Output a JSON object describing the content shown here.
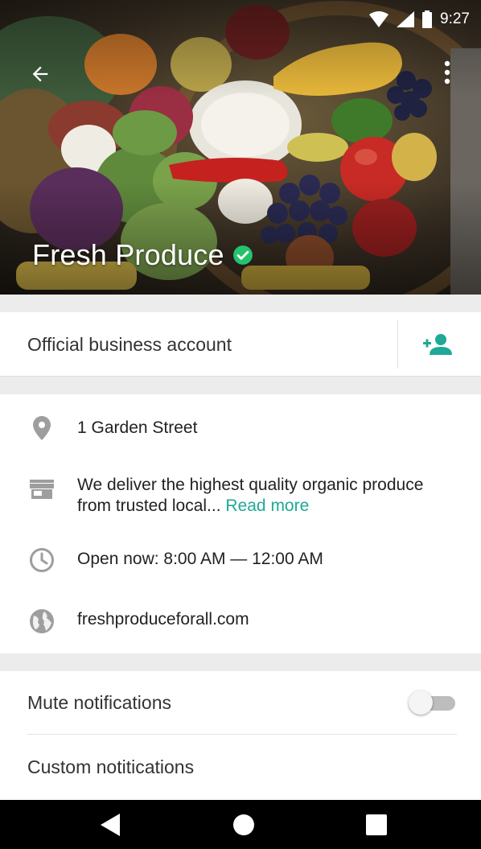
{
  "status_bar": {
    "time": "9:27"
  },
  "header": {
    "business_name": "Fresh Produce",
    "icons": {
      "back": "arrow-back-icon",
      "menu": "more-vert-icon",
      "verified": "verified-check-icon"
    },
    "verified_color": "#25c26e"
  },
  "account": {
    "label": "Official business account",
    "add_contact_icon": "add-person-icon",
    "accent": "#1fa996"
  },
  "info": {
    "address": "1 Garden Street",
    "description": "We deliver the highest quality organic produce from trusted local...",
    "read_more": "Read more",
    "hours": "Open now: 8:00 AM — 12:00 AM",
    "website": "freshproduceforall.com",
    "icons": [
      "location-pin-icon",
      "store-icon",
      "clock-icon",
      "globe-icon"
    ]
  },
  "settings": {
    "mute_label": "Mute notifications",
    "mute_enabled": false,
    "custom_label": "Custom notitications"
  },
  "nav": {
    "icons": [
      "nav-back-icon",
      "nav-home-icon",
      "nav-recents-icon"
    ]
  }
}
